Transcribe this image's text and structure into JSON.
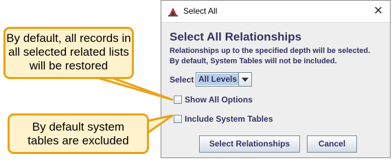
{
  "dialog": {
    "title": "Select All",
    "heading": "Select All Relationships",
    "description_line1": "Relationships up to the specified depth will be selected.",
    "description_line2": "By default, System Tables will not be included.",
    "select_label": "Select",
    "select_value": "All Levels",
    "options": {
      "show_all_options": {
        "label": "Show All Options",
        "checked": false
      },
      "include_system_tables": {
        "label": "Include System Tables",
        "checked": false
      }
    },
    "buttons": {
      "select_relationships": "Select Relationships",
      "cancel": "Cancel"
    },
    "icons": {
      "app": "app-logo-icon",
      "close": "close-icon",
      "dropdown": "chevron-down-icon"
    }
  },
  "callouts": {
    "restored": {
      "line1": "By default, all records in",
      "line2": "all selected related lists",
      "line3": "will be restored"
    },
    "excluded": {
      "line1": "By default system",
      "line2": "tables are excluded"
    }
  },
  "colors": {
    "label_text": "#333366",
    "callout_fill": "#fff2cc",
    "callout_border": "#e8a317",
    "combo_highlight": "#b8cfe5"
  }
}
